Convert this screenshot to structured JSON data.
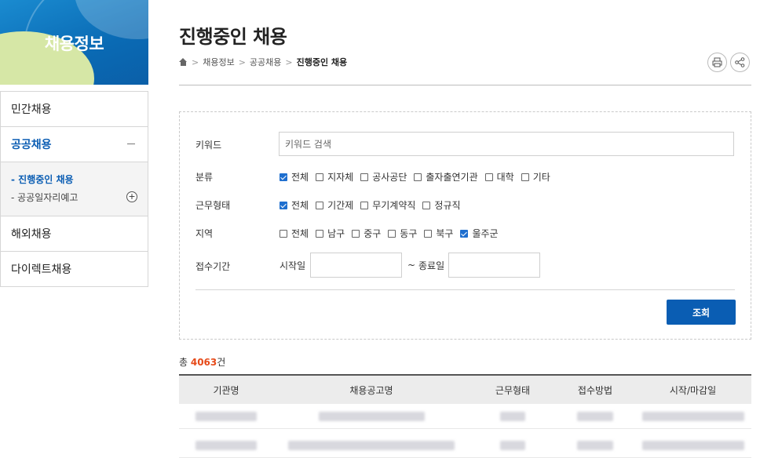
{
  "sidebar": {
    "title": "채용정보",
    "items": [
      {
        "label": "민간채용"
      },
      {
        "label": "공공채용",
        "active": true
      },
      {
        "label": "해외채용"
      },
      {
        "label": "다이렉트채용"
      }
    ],
    "sub_items": [
      {
        "label": "- 진행중인 채용",
        "active": true
      },
      {
        "label": "- 공공일자리예고"
      }
    ]
  },
  "header": {
    "title": "진행중인 채용",
    "breadcrumb": [
      "채용정보",
      "공공채용",
      "진행중인 채용"
    ]
  },
  "search": {
    "keyword_label": "키워드",
    "keyword_placeholder": "키워드 검색",
    "category_label": "분류",
    "category_options": [
      {
        "label": "전체",
        "checked": true
      },
      {
        "label": "지자체",
        "checked": false
      },
      {
        "label": "공사공단",
        "checked": false
      },
      {
        "label": "출자출연기관",
        "checked": false
      },
      {
        "label": "대학",
        "checked": false
      },
      {
        "label": "기타",
        "checked": false
      }
    ],
    "worktype_label": "근무형태",
    "worktype_options": [
      {
        "label": "전체",
        "checked": true
      },
      {
        "label": "기간제",
        "checked": false
      },
      {
        "label": "무기계약직",
        "checked": false
      },
      {
        "label": "정규직",
        "checked": false
      }
    ],
    "region_label": "지역",
    "region_options": [
      {
        "label": "전체",
        "checked": false
      },
      {
        "label": "남구",
        "checked": false
      },
      {
        "label": "중구",
        "checked": false
      },
      {
        "label": "동구",
        "checked": false
      },
      {
        "label": "북구",
        "checked": false
      },
      {
        "label": "울주군",
        "checked": true
      }
    ],
    "period_label": "접수기간",
    "start_label": "시작일",
    "tilde": "~",
    "end_label": "종료일",
    "submit_label": "조회"
  },
  "results": {
    "total_prefix": "총 ",
    "total_count": "4063",
    "total_suffix": "건",
    "columns": [
      "기관명",
      "채용공고명",
      "근무형태",
      "접수방법",
      "시작/마감일"
    ]
  },
  "colors": {
    "accent": "#0a5db3",
    "count": "#e64a19"
  }
}
